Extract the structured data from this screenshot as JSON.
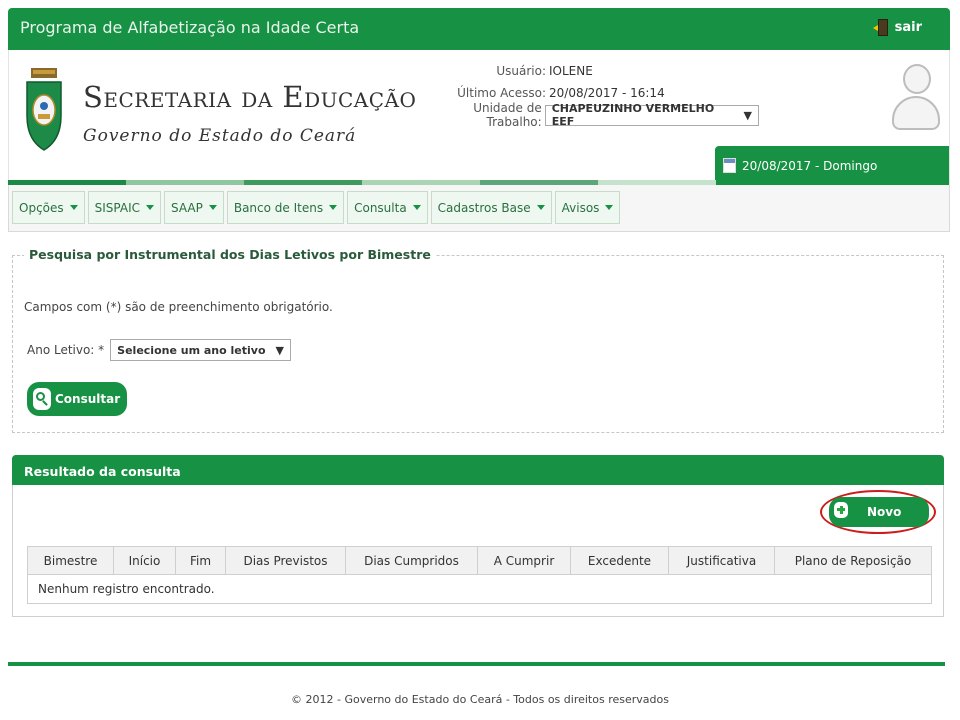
{
  "topbar": {
    "title": "Programa de Alfabetização na Idade Certa",
    "logout_label": "sair"
  },
  "logo": {
    "title": "Secretaria da Educação",
    "subtitle": "Governo do Estado do Ceará"
  },
  "user": {
    "user_label": "Usuário:",
    "user_value": "IOLENE",
    "access_label": "Último Acesso:",
    "access_value": "20/08/2017 - 16:14",
    "unit_label": "Unidade de Trabalho:",
    "unit_value": "CHAPEUZINHO VERMELHO EEF"
  },
  "date_tab": "20/08/2017 - Domingo",
  "menu": [
    {
      "label": "Opções"
    },
    {
      "label": "SISPAIC"
    },
    {
      "label": "SAAP"
    },
    {
      "label": "Banco de Itens"
    },
    {
      "label": "Consulta"
    },
    {
      "label": "Cadastros Base"
    },
    {
      "label": "Avisos"
    }
  ],
  "search": {
    "legend": "Pesquisa por Instrumental dos Dias Letivos por Bimestre",
    "required_note": "Campos com (*) são de preenchimento obrigatório.",
    "year_label": "Ano Letivo: *",
    "year_select": "Selecione um ano letivo",
    "submit_label": "Consultar"
  },
  "results": {
    "title": "Resultado da consulta",
    "new_label": "Novo",
    "columns": [
      "Bimestre",
      "Início",
      "Fim",
      "Dias Previstos",
      "Dias Cumpridos",
      "A Cumprir",
      "Excedente",
      "Justificativa",
      "Plano de Reposição"
    ],
    "empty_message": "Nenhum registro encontrado."
  },
  "footer": "© 2012 - Governo do Estado do Ceará - Todos os direitos reservados",
  "colors": {
    "brand_green": "#179143",
    "highlight_red": "#cc1c1c"
  }
}
